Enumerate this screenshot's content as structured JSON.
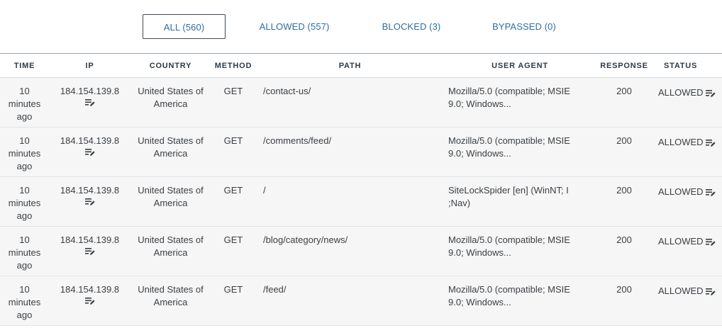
{
  "filters": [
    {
      "label": "ALL (560)",
      "active": true
    },
    {
      "label": "ALLOWED (557)",
      "active": false
    },
    {
      "label": "BLOCKED (3)",
      "active": false
    },
    {
      "label": "BYPASSED (0)",
      "active": false
    }
  ],
  "columns": {
    "time": "TIME",
    "ip": "IP",
    "country": "COUNTRY",
    "method": "METHOD",
    "path": "PATH",
    "user_agent": "USER AGENT",
    "response": "RESPONSE",
    "status": "STATUS"
  },
  "rows": [
    {
      "time": "10 minutes ago",
      "ip": "184.154.139.8",
      "country": "United States of America",
      "method": "GET",
      "path": "/contact-us/",
      "user_agent": "Mozilla/5.0 (compatible; MSIE 9.0; Windows...",
      "response": "200",
      "status": "ALLOWED"
    },
    {
      "time": "10 minutes ago",
      "ip": "184.154.139.8",
      "country": "United States of America",
      "method": "GET",
      "path": "/comments/feed/",
      "user_agent": "Mozilla/5.0 (compatible; MSIE 9.0; Windows...",
      "response": "200",
      "status": "ALLOWED"
    },
    {
      "time": "10 minutes ago",
      "ip": "184.154.139.8",
      "country": "United States of America",
      "method": "GET",
      "path": "/",
      "user_agent": "SiteLockSpider [en] (WinNT; I ;Nav)",
      "response": "200",
      "status": "ALLOWED"
    },
    {
      "time": "10 minutes ago",
      "ip": "184.154.139.8",
      "country": "United States of America",
      "method": "GET",
      "path": "/blog/category/news/",
      "user_agent": "Mozilla/5.0 (compatible; MSIE 9.0; Windows...",
      "response": "200",
      "status": "ALLOWED"
    },
    {
      "time": "10 minutes ago",
      "ip": "184.154.139.8",
      "country": "United States of America",
      "method": "GET",
      "path": "/feed/",
      "user_agent": "Mozilla/5.0 (compatible; MSIE 9.0; Windows...",
      "response": "200",
      "status": "ALLOWED"
    }
  ],
  "icons": {
    "ip_action": "edit-list-icon",
    "status_action": "edit-list-icon"
  },
  "colors": {
    "link": "#2f6f9f",
    "row_bg": "#f6f6f6",
    "header_text": "#2e3a46"
  }
}
